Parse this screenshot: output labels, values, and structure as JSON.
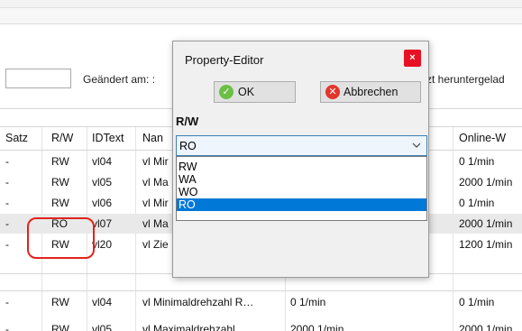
{
  "info": {
    "changed_label": "Geändert am: :",
    "changed_tail": "zt heruntergelad"
  },
  "table": {
    "headers": {
      "satz": "Satz",
      "rw": "R/W",
      "idtext": "IDText",
      "name": "Nan",
      "online": "Online-W"
    },
    "rows": [
      {
        "satz": "-",
        "rw": "RW",
        "id": "vl04",
        "name": "vl Mir",
        "value": "",
        "online": "0 1/min",
        "highlight": false
      },
      {
        "satz": "-",
        "rw": "RW",
        "id": "vl05",
        "name": "vl Ma",
        "value": "",
        "online": "2000 1/min",
        "highlight": false
      },
      {
        "satz": "-",
        "rw": "RW",
        "id": "vl06",
        "name": "vl Mir",
        "value": "",
        "online": "0 1/min",
        "highlight": false
      },
      {
        "satz": "-",
        "rw": "RO",
        "id": "vl07",
        "name": "vl Ma",
        "value": "",
        "online": "2000 1/min",
        "highlight": true
      },
      {
        "satz": "-",
        "rw": "RW",
        "id": "vl20",
        "name": "vl Zie",
        "value": "",
        "online": "1200 1/min",
        "highlight": false
      },
      {
        "satz": "",
        "rw": "",
        "id": "",
        "name": "",
        "value": "",
        "online": "",
        "highlight": false
      },
      {
        "satz": "-",
        "rw": "RW",
        "id": "vl04",
        "name": "vl Minimaldrehzahl R…",
        "value": "0 1/min",
        "online": "0 1/min",
        "highlight": false
      },
      {
        "satz": "-",
        "rw": "RW",
        "id": "vl05",
        "name": "vl Maximaldrehzahl",
        "value": "2000 1/min",
        "online": "2000 1/min",
        "highlight": false
      }
    ]
  },
  "dialog": {
    "title": "Property-Editor",
    "close_glyph": "×",
    "ok_label": "OK",
    "ok_glyph": "✓",
    "cancel_label": "Abbrechen",
    "cancel_glyph": "✕",
    "property_label": "R/W",
    "selected_value": "RO",
    "options": [
      "RW",
      "WA",
      "WO",
      "RO"
    ],
    "selected_index": 3
  },
  "colors": {
    "accent": "#0078d7",
    "close_button": "#e81123",
    "annotation": "#e2231a",
    "ok_icon": "#6cbf45",
    "cancel_icon": "#e5342b"
  }
}
